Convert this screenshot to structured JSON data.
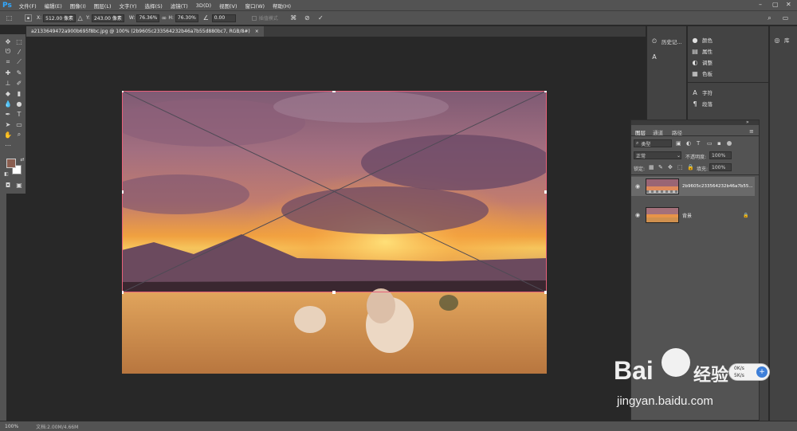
{
  "app": {
    "logo": "Ps"
  },
  "menu": [
    "文件(F)",
    "编辑(E)",
    "图像(I)",
    "图层(L)",
    "文字(Y)",
    "选择(S)",
    "滤镜(T)",
    "3D(D)",
    "视图(V)",
    "窗口(W)",
    "帮助(H)"
  ],
  "options": {
    "x_label": "X:",
    "x_value": "512.00 像素",
    "y_label": "Y:",
    "y_value": "243.00 像素",
    "w_label": "W:",
    "w_value": "76.36%",
    "h_label": "H:",
    "h_value": "76.30%",
    "angle_value": "0.00",
    "interp_label": "插值模式"
  },
  "document_tab": "a2133649472a900b695f8bc.jpg @ 100% (2b9605c233564232b46a7b55d880bc7, RGB/8#)",
  "history_panel": {
    "label": "历史记..."
  },
  "side_panels": [
    {
      "icon": "palette-icon",
      "glyph": "●",
      "label": "颜色"
    },
    {
      "icon": "properties-icon",
      "glyph": "▤",
      "label": "属性"
    },
    {
      "icon": "adjustments-icon",
      "glyph": "◐",
      "label": "调整"
    },
    {
      "icon": "swatches-icon",
      "glyph": "▦",
      "label": "色板"
    },
    {
      "icon": "character-icon",
      "glyph": "A",
      "label": "字符"
    },
    {
      "icon": "paragraph-icon",
      "glyph": "¶",
      "label": "段落"
    }
  ],
  "libraries": {
    "label": "库"
  },
  "layers_panel": {
    "tabs": [
      "图层",
      "通道",
      "路径"
    ],
    "filter_label": "类型",
    "blend_mode": "正常",
    "opacity_label": "不透明度:",
    "opacity_value": "100%",
    "lock_label": "锁定:",
    "fill_label": "填充:",
    "fill_value": "100%",
    "layers": [
      {
        "name": "2b9605c233564232b46a7b55..."
      },
      {
        "name": "背景"
      }
    ]
  },
  "status": {
    "zoom": "100%",
    "doc_info": "文档:2.00M/4.66M"
  },
  "watermark": {
    "brand": "Bai",
    "brand_cn": "经验",
    "url": "jingyan.baidu.com",
    "speed_up": "0K/s",
    "speed_down": "5K/s"
  }
}
